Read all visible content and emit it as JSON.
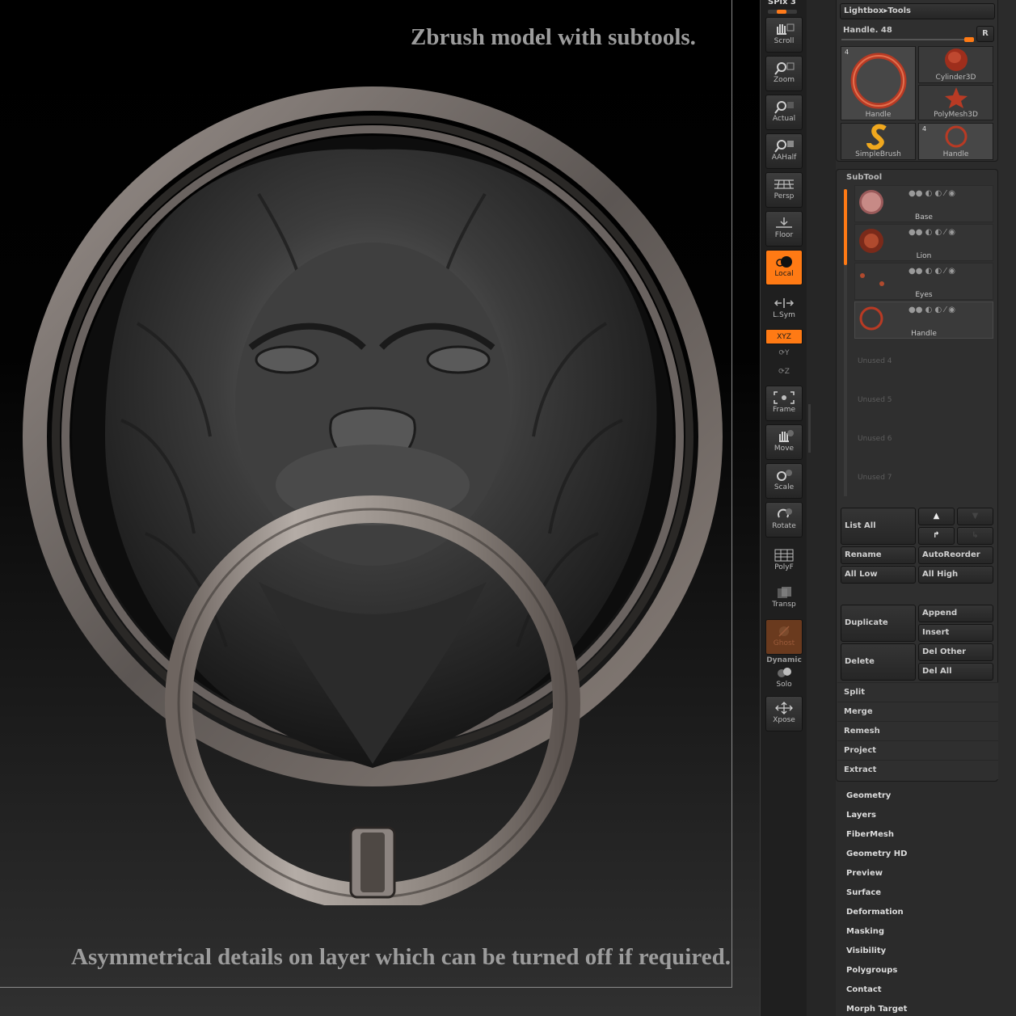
{
  "viewport": {
    "caption_top": "Zbrush model with subtools.",
    "caption_bottom": "Asymmetrical details on layer which can be turned off if required."
  },
  "shelf": {
    "spix": "SPix 3",
    "buttons": [
      {
        "label": "Scroll",
        "icon": "hand-icon"
      },
      {
        "label": "Zoom",
        "icon": "magnifier-icon"
      },
      {
        "label": "Actual",
        "icon": "magnifier-icon"
      },
      {
        "label": "AAHalf",
        "icon": "magnifier-icon"
      },
      {
        "label": "Persp",
        "icon": "grid-icon"
      },
      {
        "label": "Floor",
        "icon": "floor-icon"
      },
      {
        "label": "Local",
        "icon": "local-icon"
      },
      {
        "label": "L.Sym",
        "icon": "symmetry-icon"
      },
      {
        "label": "Frame",
        "icon": "frame-icon"
      },
      {
        "label": "Move",
        "icon": "hand-icon"
      },
      {
        "label": "Scale",
        "icon": "scale-icon"
      },
      {
        "label": "Rotate",
        "icon": "rotate-icon"
      },
      {
        "label": "PolyF",
        "icon": "polyframe-icon"
      },
      {
        "label": "Transp",
        "icon": "transparency-icon"
      },
      {
        "label": "Ghost",
        "icon": "ghost-icon"
      },
      {
        "label": "Solo",
        "icon": "solo-icon"
      },
      {
        "label": "Xpose",
        "icon": "xpose-icon"
      }
    ],
    "xyz": "XYZ",
    "dynamic": "Dynamic",
    "axis_y": "Y",
    "axis_z": "Z"
  },
  "tool_panel": {
    "breadcrumb": "Lightbox",
    "breadcrumb_sep": "▸",
    "breadcrumb_tools": "Tools",
    "current_tool": "Handle. 48",
    "r_button": "R",
    "thumbs": [
      {
        "label": "Handle",
        "count": "4"
      },
      {
        "label": "Cylinder3D",
        "count": ""
      },
      {
        "label": "PolyMesh3D",
        "count": ""
      },
      {
        "label": "SimpleBrush",
        "count": ""
      },
      {
        "label": "Handle",
        "count": "4"
      }
    ]
  },
  "subtool": {
    "title": "SubTool",
    "items": [
      "Base",
      "Lion",
      "Eyes",
      "Handle"
    ],
    "unused": [
      "Unused 4",
      "Unused 5",
      "Unused 6",
      "Unused 7"
    ],
    "list_all": "List  All",
    "rename": "Rename",
    "autoreorder": "AutoReorder",
    "all_low": "All Low",
    "all_high": "All High",
    "duplicate": "Duplicate",
    "append": "Append",
    "insert": "Insert",
    "delete": "Delete",
    "del_other": "Del Other",
    "del_all": "Del All",
    "menus": [
      "Split",
      "Merge",
      "Remesh",
      "Project",
      "Extract"
    ]
  },
  "sections": [
    "Geometry",
    "Layers",
    "FiberMesh",
    "Geometry HD",
    "Preview",
    "Surface",
    "Deformation",
    "Masking",
    "Visibility",
    "Polygroups",
    "Contact",
    "Morph Target"
  ],
  "colors": {
    "accent": "#ff7a14",
    "panel": "#2f2f2f",
    "background": "#2b2b2b"
  }
}
